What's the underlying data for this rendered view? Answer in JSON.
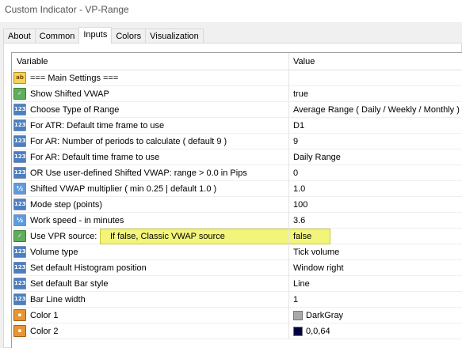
{
  "window": {
    "title": "Custom Indicator - VP-Range"
  },
  "tabs": [
    {
      "label": "About"
    },
    {
      "label": "Common"
    },
    {
      "label": "Inputs"
    },
    {
      "label": "Colors"
    },
    {
      "label": "Visualization"
    }
  ],
  "grid": {
    "header": {
      "variable": "Variable",
      "value": "Value"
    },
    "rows": [
      {
        "icon": "string-ab-icon",
        "name": "=== Main Settings ===",
        "value": ""
      },
      {
        "icon": "bool-icon",
        "name": "Show Shifted VWAP",
        "value": "true"
      },
      {
        "icon": "int-123-icon",
        "name": "Choose Type of Range",
        "value": "Average Range ( Daily / Weekly / Monthly )"
      },
      {
        "icon": "int-123-icon",
        "name": "For ATR: Default time frame to use",
        "value": "D1"
      },
      {
        "icon": "int-123-icon",
        "name": "For   AR: Number of periods to calculate ( default 9 )",
        "value": "9"
      },
      {
        "icon": "int-123-icon",
        "name": "For   AR: Default time frame to use",
        "value": "Daily Range"
      },
      {
        "icon": "int-123-icon",
        "name": "OR Use user-defined Shifted VWAP: range > 0.0 in Pips",
        "value": "0"
      },
      {
        "icon": "double-icon",
        "name": "Shifted VWAP multiplier ( min 0.25 | default 1.0 )",
        "value": "1.0"
      },
      {
        "icon": "int-123-icon",
        "name": "Mode step (points)",
        "value": "100"
      },
      {
        "icon": "double-icon",
        "name": "Work speed - in minutes",
        "value": "3.6"
      },
      {
        "icon": "bool-icon",
        "name": "Use VPR source:",
        "note": "If false, Classic VWAP source",
        "value": "false"
      },
      {
        "icon": "int-123-icon",
        "name": "Volume type",
        "value": "Tick volume"
      },
      {
        "icon": "int-123-icon",
        "name": "Set default Histogram position",
        "value": "Window right"
      },
      {
        "icon": "int-123-icon",
        "name": "Set default Bar style",
        "value": "Line"
      },
      {
        "icon": "int-123-icon",
        "name": "Bar Line width",
        "value": "1"
      },
      {
        "icon": "color-icon",
        "name": "Color 1",
        "value": "DarkGray",
        "swatch": "#a9a9a9"
      },
      {
        "icon": "color-icon",
        "name": "Color 2",
        "value": "0,0,64",
        "swatch": "#000040"
      }
    ]
  },
  "icon_glyphs": {
    "str": "ab",
    "num": "123",
    "frac": "½",
    "bool": "✓",
    "color": "▪"
  },
  "colors": {
    "highlight": "#f3f57a"
  }
}
